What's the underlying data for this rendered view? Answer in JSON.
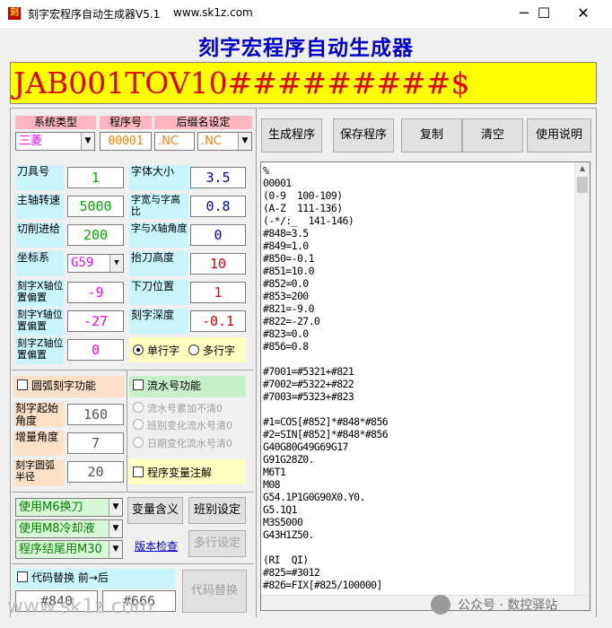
{
  "window": {
    "title": "刻字宏程序自动生成器V5.1",
    "url_text": "www.sk1z.com",
    "min_glyph": "─",
    "max_glyph": "☐",
    "close_glyph": "✕"
  },
  "heading": "刻字宏程序自动生成器",
  "input_text": "JAB001TOV10#########$",
  "system": {
    "header_type": "系统类型",
    "header_prog": "程序号",
    "header_suffix": "后缀名设定",
    "type_value": "三菱",
    "prog_value": "00001",
    "suffix_text": ".NC",
    "suffix_select": ".NC"
  },
  "params_left": [
    {
      "label": "刀具号",
      "value": "1"
    },
    {
      "label": "主轴转速",
      "value": "5000"
    },
    {
      "label": "切削进给",
      "value": "200"
    },
    {
      "label": "坐标系",
      "value": "G59"
    },
    {
      "label": "刻字X轴位置偏置",
      "value": "-9"
    },
    {
      "label": "刻字Y轴位置偏置",
      "value": "-27"
    },
    {
      "label": "刻字Z轴位置偏置",
      "value": "0"
    }
  ],
  "params_right": [
    {
      "label": "字体大小",
      "value": "3.5"
    },
    {
      "label": "字宽与字高比",
      "value": "0.8"
    },
    {
      "label": "字与X轴角度",
      "value": "0"
    },
    {
      "label": "抬刀高度",
      "value": "10"
    },
    {
      "label": "下刀位置",
      "value": "1"
    },
    {
      "label": "刻字深度",
      "value": "-0.1"
    }
  ],
  "line_mode": {
    "single": "单行字",
    "multi": "多行字"
  },
  "arc": {
    "title": "圆弧刻字功能",
    "start_label": "刻字起始角度",
    "start_value": "160",
    "inc_label": "增量角度",
    "inc_value": "7",
    "radius_label": "刻字圆弧半径",
    "radius_value": "20"
  },
  "serial": {
    "title": "流水号功能",
    "opt1": "流水号累加不清0",
    "opt2": "班别变化流水号清0",
    "opt3": "日期变化流水号清0"
  },
  "var_comment": "程序变量注解",
  "m_codes": [
    "使用M6换刀",
    "使用M8冷却液",
    "程序结尾用M30"
  ],
  "buttons": {
    "generate": "生成程序",
    "save": "保存程序",
    "copy": "复制",
    "clear": "清空",
    "help": "使用说明",
    "var_meaning": "变量含义",
    "shift": "班别设定",
    "version_check": "版本检查",
    "multi_line": "多行设定",
    "code_replace": "代码替换"
  },
  "replace": {
    "title": "代码替换 前→后",
    "from": "#840",
    "to": "#666"
  },
  "code_text": "%\n00001\n(0-9  100-109)\n(A-Z  111-136)\n(-*/:_  141-146)\n#848=3.5\n#849=1.0\n#850=-0.1\n#851=10.0\n#852=0.0\n#853=200\n#821=-9.0\n#822=-27.0\n#823=0.0\n#856=0.8\n\n#7001=#5321+#821\n#7002=#5322+#822\n#7003=#5323+#823\n\n#1=COS[#852]*#848*#856\n#2=SIN[#852]*#848*#856\nG40G80G49G69G17\nG91G28Z0.\nM6T1\nM08\nG54.1P1G0G90X0.Y0.\nG5.1Q1\nM3S5000\nG43H1Z50.\n\n(RI  QI)\n#825=#3012\n#826=FIX[#825/100000]",
  "watermark_url": "www.sk1z.com",
  "watermark_brand": "公众号 · 数控驿站",
  "colors": {
    "heading": "#0000cc",
    "input_bg": "#ffff00",
    "input_fg": "#e00000",
    "value_green": "#00b000",
    "value_blue": "#0000cc",
    "value_red": "#e00000",
    "value_magenta": "#ff00ff",
    "value_orange": "#ff8000"
  }
}
